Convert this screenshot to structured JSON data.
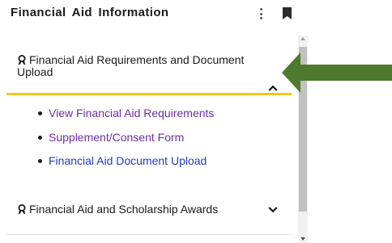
{
  "header": {
    "title": "Financial Aid Information",
    "more_menu_icon": "kebab-vertical-icon",
    "bookmark_icon": "bookmark-icon"
  },
  "accordion": [
    {
      "label": "Financial Aid Requirements and Document Upload",
      "icon": "award-ribbon-icon",
      "expanded": true,
      "chevron_icon": "chevron-up-icon",
      "links": [
        {
          "label": "View Financial Aid Requirements",
          "visited": true
        },
        {
          "label": "Supplement/Consent Form",
          "visited": true
        },
        {
          "label": "Financial Aid Document Upload",
          "visited": false
        }
      ]
    },
    {
      "label": "Financial Aid and Scholarship Awards",
      "icon": "award-ribbon-icon",
      "expanded": false,
      "chevron_icon": "chevron-down-icon"
    }
  ],
  "colors": {
    "accent_underline": "#f5c518",
    "visited_link": "#6b2fa3",
    "link": "#1f3fbf",
    "annotation_arrow": "#4e7a2e"
  },
  "annotation": {
    "icon": "pointer-arrow-icon"
  }
}
